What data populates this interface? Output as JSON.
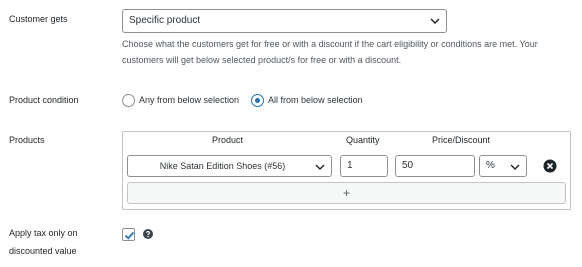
{
  "customer_gets": {
    "label": "Customer gets",
    "selected": "Specific product",
    "description": "Choose what the customers get for free or with a discount if the cart eligibility or conditions are met. Your customers will get below selected product/s for free or with a discount."
  },
  "product_condition": {
    "label": "Product condition",
    "options": [
      {
        "label": "Any from below selection",
        "checked": false
      },
      {
        "label": "All from below selection",
        "checked": true
      }
    ]
  },
  "products": {
    "label": "Products",
    "columns": {
      "product": "Product",
      "quantity": "Quantity",
      "price_discount": "Price/Discount"
    },
    "rows": [
      {
        "product": "Nike Satan Edition Shoes (#56)",
        "quantity": "1",
        "discount_value": "50",
        "discount_type": "%"
      }
    ],
    "add_label": "+"
  },
  "apply_tax": {
    "label_line1": "Apply tax only on",
    "label_line2": "discounted value",
    "checked": true
  },
  "colors": {
    "accent": "#2271b1",
    "text": "#1d2327",
    "border": "#8c8f94"
  }
}
